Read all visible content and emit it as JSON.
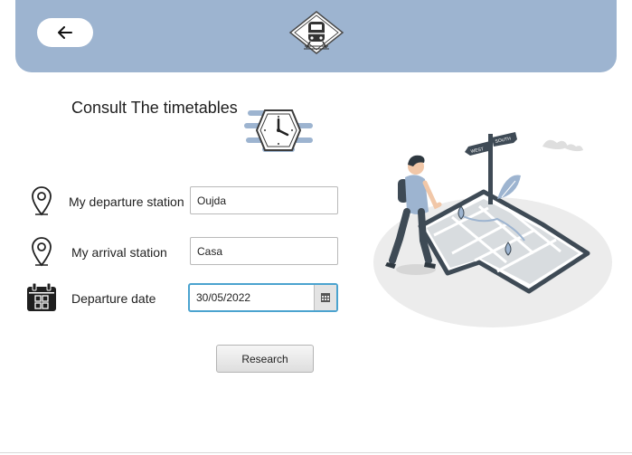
{
  "header": {
    "back_icon": "arrow-left-icon",
    "logo_icon": "train-logo-icon",
    "color": "#9db4d0"
  },
  "main": {
    "title": "Consult The timetables",
    "title_icon": "clock-icon"
  },
  "form": {
    "departure": {
      "icon": "location-pin-icon",
      "label": "My departure station",
      "value": "Oujda"
    },
    "arrival": {
      "icon": "location-pin-icon",
      "label": "My arrival station",
      "value": "Casa"
    },
    "date": {
      "icon": "calendar-icon",
      "label": "Departure date",
      "value": "30/05/2022",
      "picker_icon": "calendar-picker-icon",
      "focus_color": "#4ba3cf"
    },
    "submit_label": "Research"
  },
  "illustration": {
    "sign_labels": [
      "WEST",
      "SOUTH"
    ]
  }
}
